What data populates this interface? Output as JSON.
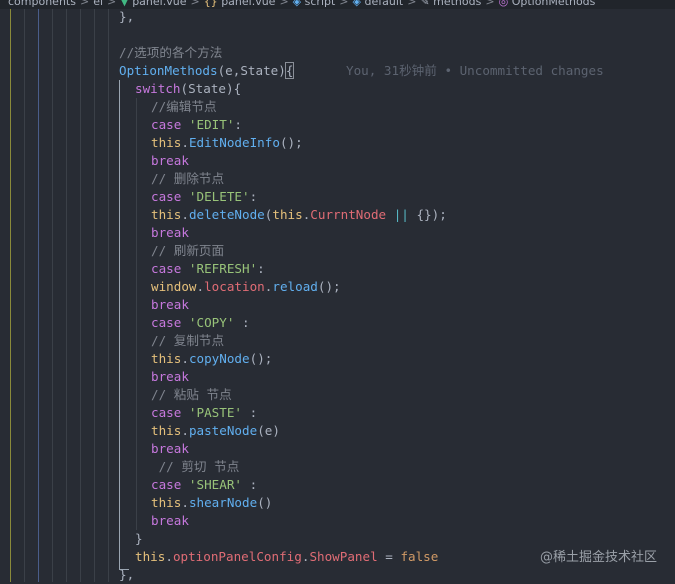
{
  "breadcrumb": {
    "items": [
      {
        "label": "components",
        "icon": ""
      },
      {
        "label": "el",
        "icon": ""
      },
      {
        "label": "panel.vue",
        "icon": "vue-icon"
      },
      {
        "label": "panel.vue",
        "icon": "braces-icon"
      },
      {
        "label": "script",
        "icon": "cube-icon"
      },
      {
        "label": "default",
        "icon": "cube-icon"
      },
      {
        "label": "methods",
        "icon": "wrench-icon"
      },
      {
        "label": "OptionMethods",
        "icon": "method-icon"
      }
    ],
    "separator": ">"
  },
  "editor": {
    "blame": "You, 31秒钟前 • Uncommitted changes",
    "lines": [
      {
        "tokens": [
          {
            "t": "},",
            "c": "pl"
          }
        ]
      },
      {
        "tokens": []
      },
      {
        "tokens": [
          {
            "t": "//选项的各个方法",
            "c": "cm"
          }
        ]
      },
      {
        "tokens": [
          {
            "t": "OptionMethods",
            "c": "fn"
          },
          {
            "t": "(e,State)",
            "c": "pl"
          },
          {
            "t": "{",
            "c": "pl bracket"
          }
        ]
      },
      {
        "tokens": [
          {
            "t": "switch",
            "c": "kw"
          },
          {
            "t": "(State){",
            "c": "pl"
          }
        ]
      },
      {
        "tokens": [
          {
            "t": "//编辑节点",
            "c": "cm"
          }
        ]
      },
      {
        "tokens": [
          {
            "t": "case ",
            "c": "kw"
          },
          {
            "t": "'EDIT'",
            "c": "str"
          },
          {
            "t": ":",
            "c": "pl"
          }
        ]
      },
      {
        "tokens": [
          {
            "t": "this",
            "c": "th"
          },
          {
            "t": ".",
            "c": "pl"
          },
          {
            "t": "EditNodeInfo",
            "c": "fn"
          },
          {
            "t": "();",
            "c": "pl"
          }
        ]
      },
      {
        "tokens": [
          {
            "t": "break",
            "c": "kw"
          }
        ]
      },
      {
        "tokens": [
          {
            "t": "// 删除节点",
            "c": "cm"
          }
        ]
      },
      {
        "tokens": [
          {
            "t": "case ",
            "c": "kw"
          },
          {
            "t": "'DELETE'",
            "c": "str"
          },
          {
            "t": ":",
            "c": "pl"
          }
        ]
      },
      {
        "tokens": [
          {
            "t": "this",
            "c": "th"
          },
          {
            "t": ".",
            "c": "pl"
          },
          {
            "t": "deleteNode",
            "c": "fn"
          },
          {
            "t": "(",
            "c": "pl"
          },
          {
            "t": "this",
            "c": "th"
          },
          {
            "t": ".",
            "c": "pl"
          },
          {
            "t": "CurrntNode",
            "c": "prop"
          },
          {
            "t": " || ",
            "c": "op"
          },
          {
            "t": "{});",
            "c": "pl"
          }
        ]
      },
      {
        "tokens": [
          {
            "t": "break",
            "c": "kw"
          }
        ]
      },
      {
        "tokens": [
          {
            "t": "// 刷新页面",
            "c": "cm"
          }
        ]
      },
      {
        "tokens": [
          {
            "t": "case ",
            "c": "kw"
          },
          {
            "t": "'REFRESH'",
            "c": "str"
          },
          {
            "t": ":",
            "c": "pl"
          }
        ]
      },
      {
        "tokens": [
          {
            "t": "window",
            "c": "th"
          },
          {
            "t": ".",
            "c": "pl"
          },
          {
            "t": "location",
            "c": "prop"
          },
          {
            "t": ".",
            "c": "pl"
          },
          {
            "t": "reload",
            "c": "fn"
          },
          {
            "t": "();",
            "c": "pl"
          }
        ]
      },
      {
        "tokens": [
          {
            "t": "break",
            "c": "kw"
          }
        ]
      },
      {
        "tokens": [
          {
            "t": "case ",
            "c": "kw"
          },
          {
            "t": "'COPY'",
            "c": "str"
          },
          {
            "t": " :",
            "c": "pl"
          }
        ]
      },
      {
        "tokens": [
          {
            "t": "// 复制节点",
            "c": "cm"
          }
        ]
      },
      {
        "tokens": [
          {
            "t": "this",
            "c": "th"
          },
          {
            "t": ".",
            "c": "pl"
          },
          {
            "t": "copyNode",
            "c": "fn"
          },
          {
            "t": "();",
            "c": "pl"
          }
        ]
      },
      {
        "tokens": [
          {
            "t": "break",
            "c": "kw"
          }
        ]
      },
      {
        "tokens": [
          {
            "t": "// 粘贴 节点",
            "c": "cm"
          }
        ]
      },
      {
        "tokens": [
          {
            "t": "case ",
            "c": "kw"
          },
          {
            "t": "'PASTE'",
            "c": "str"
          },
          {
            "t": " :",
            "c": "pl"
          }
        ]
      },
      {
        "tokens": [
          {
            "t": "this",
            "c": "th"
          },
          {
            "t": ".",
            "c": "pl"
          },
          {
            "t": "pasteNode",
            "c": "fn"
          },
          {
            "t": "(e)",
            "c": "pl"
          }
        ]
      },
      {
        "tokens": [
          {
            "t": "break",
            "c": "kw"
          }
        ]
      },
      {
        "tokens": [
          {
            "t": " // 剪切 节点",
            "c": "cm"
          }
        ]
      },
      {
        "tokens": [
          {
            "t": "case ",
            "c": "kw"
          },
          {
            "t": "'SHEAR'",
            "c": "str"
          },
          {
            "t": " :",
            "c": "pl"
          }
        ]
      },
      {
        "tokens": [
          {
            "t": "this",
            "c": "th"
          },
          {
            "t": ".",
            "c": "pl"
          },
          {
            "t": "shearNode",
            "c": "fn"
          },
          {
            "t": "()",
            "c": "pl"
          }
        ]
      },
      {
        "tokens": [
          {
            "t": "break",
            "c": "kw"
          }
        ]
      },
      {
        "tokens": [
          {
            "t": "}",
            "c": "pl"
          }
        ]
      },
      {
        "tokens": [
          {
            "t": "this",
            "c": "th"
          },
          {
            "t": ".",
            "c": "pl"
          },
          {
            "t": "optionPanelConfig",
            "c": "prop"
          },
          {
            "t": ".",
            "c": "pl"
          },
          {
            "t": "ShowPanel",
            "c": "prop"
          },
          {
            "t": " = ",
            "c": "pl"
          },
          {
            "t": "false",
            "c": "bool"
          }
        ]
      },
      {
        "tokens": [
          {
            "t": "},",
            "c": "pl"
          }
        ]
      }
    ]
  },
  "watermark": "@稀土掘金技术社区"
}
